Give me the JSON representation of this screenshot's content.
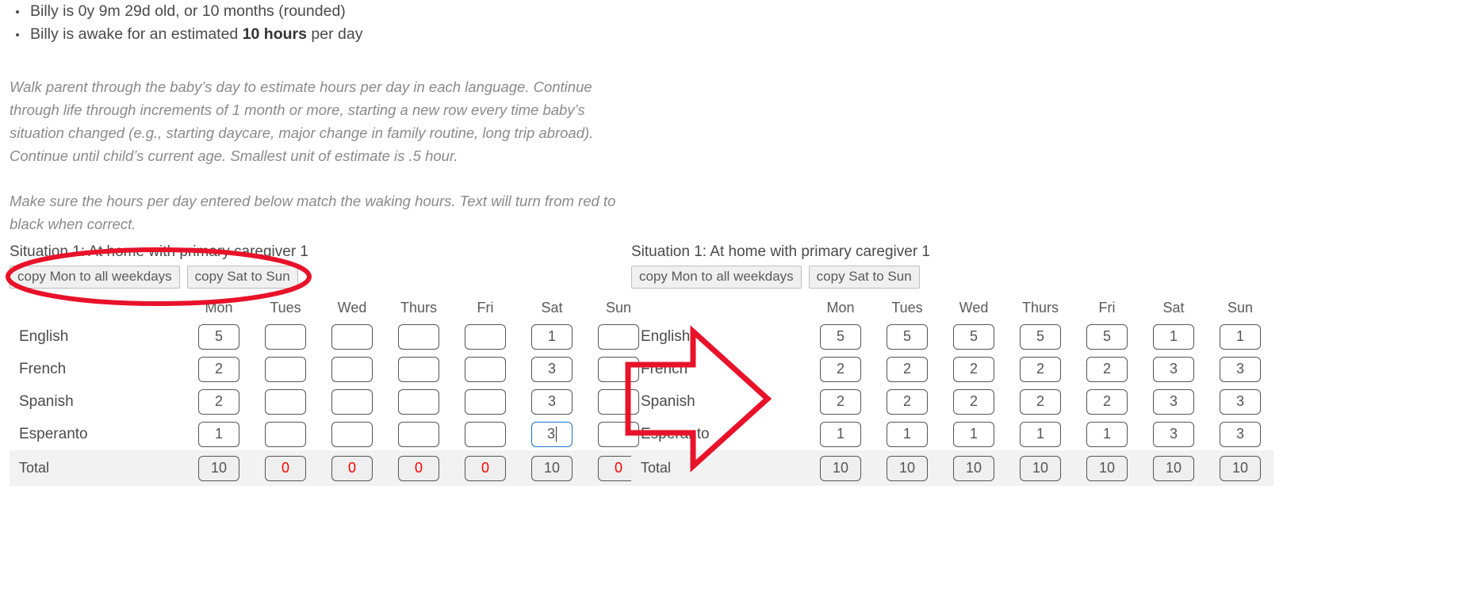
{
  "intro": {
    "bullets": [
      {
        "text_before": "Billy is 0y 9m 29d old, or 10 months (rounded)",
        "bold": "",
        "text_after": ""
      },
      {
        "text_before": "Billy is awake for an estimated ",
        "bold": "10 hours",
        "text_after": " per day"
      }
    ]
  },
  "instructions": {
    "paragraph_1": "Walk parent through the baby’s day to estimate hours per day in each language. Continue through life through increments of 1 month or more, starting a new row every time baby’s situation changed (e.g., starting daycare, major change in family routine, long trip abroad). Continue until child’s current age. Smallest unit of estimate is .5 hour.",
    "paragraph_2": "Make sure the hours per day entered below match the waking hours. Text will turn from red to black when correct."
  },
  "colors": {
    "annotation_red": "#e8122a",
    "focus_blue": "#1a73c7",
    "error_red": "#ff0000",
    "text_gray": "#4a4a4a",
    "muted_gray": "#8a8a8a"
  },
  "days": [
    "Mon",
    "Tues",
    "Wed",
    "Thurs",
    "Fri",
    "Sat",
    "Sun"
  ],
  "languages": [
    "English",
    "French",
    "Spanish",
    "Esperanto"
  ],
  "total_label": "Total",
  "left_panel": {
    "title": "Situation 1: At home with primary caregiver 1",
    "buttons": {
      "copy_weekdays": "copy Mon to all weekdays",
      "copy_sat_sun": "copy Sat to Sun"
    },
    "rows": [
      {
        "label": "English",
        "values": [
          "5",
          "",
          "",
          "",
          "",
          "1",
          ""
        ]
      },
      {
        "label": "French",
        "values": [
          "2",
          "",
          "",
          "",
          "",
          "3",
          ""
        ]
      },
      {
        "label": "Spanish",
        "values": [
          "2",
          "",
          "",
          "",
          "",
          "3",
          ""
        ]
      },
      {
        "label": "Esperanto",
        "values": [
          "1",
          "",
          "",
          "",
          "",
          "3",
          ""
        ]
      }
    ],
    "focused_cell": {
      "row": 3,
      "col": 5
    },
    "totals": [
      "10",
      "0",
      "0",
      "0",
      "0",
      "10",
      "0"
    ]
  },
  "right_panel": {
    "title": "Situation 1: At home with primary caregiver 1",
    "buttons": {
      "copy_weekdays": "copy Mon to all weekdays",
      "copy_sat_sun": "copy Sat to Sun"
    },
    "rows": [
      {
        "label": "English",
        "values": [
          "5",
          "5",
          "5",
          "5",
          "5",
          "1",
          "1"
        ]
      },
      {
        "label": "French",
        "values": [
          "2",
          "2",
          "2",
          "2",
          "2",
          "3",
          "3"
        ]
      },
      {
        "label": "Spanish",
        "values": [
          "2",
          "2",
          "2",
          "2",
          "2",
          "3",
          "3"
        ]
      },
      {
        "label": "Esperanto",
        "values": [
          "1",
          "1",
          "1",
          "1",
          "1",
          "3",
          "3"
        ]
      }
    ],
    "totals": [
      "10",
      "10",
      "10",
      "10",
      "10",
      "10",
      "10"
    ]
  },
  "annotations": {
    "ellipse_target": "copy buttons row of left panel",
    "arrow_direction": "left-to-right, pointing from left table to right table"
  }
}
